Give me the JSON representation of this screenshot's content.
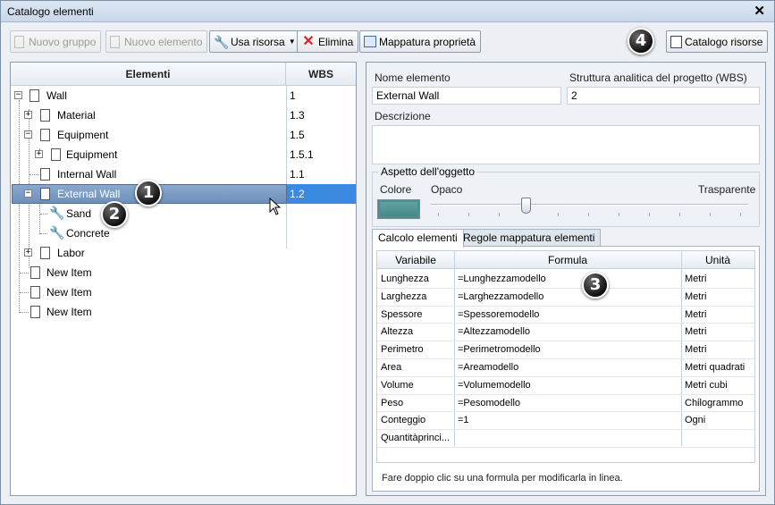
{
  "window": {
    "title": "Catalogo elementi"
  },
  "toolbar": {
    "new_group": "Nuovo gruppo",
    "new_element": "Nuovo elemento",
    "use_resource": "Usa risorsa",
    "delete": "Elimina",
    "property_mapping": "Mappatura proprietà",
    "resource_catalog": "Catalogo risorse"
  },
  "callouts": [
    "1",
    "2",
    "3",
    "4"
  ],
  "tree": {
    "col_elements": "Elementi",
    "col_wbs": "WBS",
    "rows": [
      {
        "label": "Wall",
        "wbs": "1"
      },
      {
        "label": "Material",
        "wbs": "1.3"
      },
      {
        "label": "Equipment",
        "wbs": "1.5"
      },
      {
        "label": "Equipment",
        "wbs": "1.5.1"
      },
      {
        "label": "Internal Wall",
        "wbs": "1.1"
      },
      {
        "label": "External Wall",
        "wbs": "1.2"
      },
      {
        "label": "Sand",
        "wbs": ""
      },
      {
        "label": "Concrete",
        "wbs": ""
      },
      {
        "label": "Labor",
        "wbs": ""
      },
      {
        "label": "New Item",
        "wbs": ""
      },
      {
        "label": "New Item",
        "wbs": ""
      },
      {
        "label": "New Item",
        "wbs": ""
      }
    ]
  },
  "details": {
    "name_label": "Nome elemento",
    "name_value": "External Wall",
    "wbs_label": "Struttura analitica del progetto (WBS)",
    "wbs_value": "2",
    "description_label": "Descrizione",
    "description_value": "",
    "appearance_title": "Aspetto dell'oggetto",
    "color_label": "Colore",
    "opaque_label": "Opaco",
    "transparent_label": "Trasparente",
    "transparency": 0.3,
    "color": "#4f8f8f"
  },
  "tabs": [
    "Calcolo elementi",
    "Regole mappatura elementi"
  ],
  "grid": {
    "headers": [
      "Variabile",
      "Formula",
      "Unità"
    ],
    "rows": [
      [
        "Lunghezza",
        "=Lunghezzamodello",
        "Metri"
      ],
      [
        "Larghezza",
        "=Larghezzamodello",
        "Metri"
      ],
      [
        "Spessore",
        "=Spessoremodello",
        "Metri"
      ],
      [
        "Altezza",
        "=Altezzamodello",
        "Metri"
      ],
      [
        "Perimetro",
        "=Perimetromodello",
        "Metri"
      ],
      [
        "Area",
        "=Areamodello",
        "Metri quadrati"
      ],
      [
        "Volume",
        "=Volumemodello",
        "Metri cubi"
      ],
      [
        "Peso",
        "=Pesomodello",
        "Chilogrammo"
      ],
      [
        "Conteggio",
        "=1",
        "Ogni"
      ],
      [
        "Quantitàprinci...",
        "",
        ""
      ]
    ]
  },
  "hint": "Fare doppio clic su una formula per modificarla in linea."
}
